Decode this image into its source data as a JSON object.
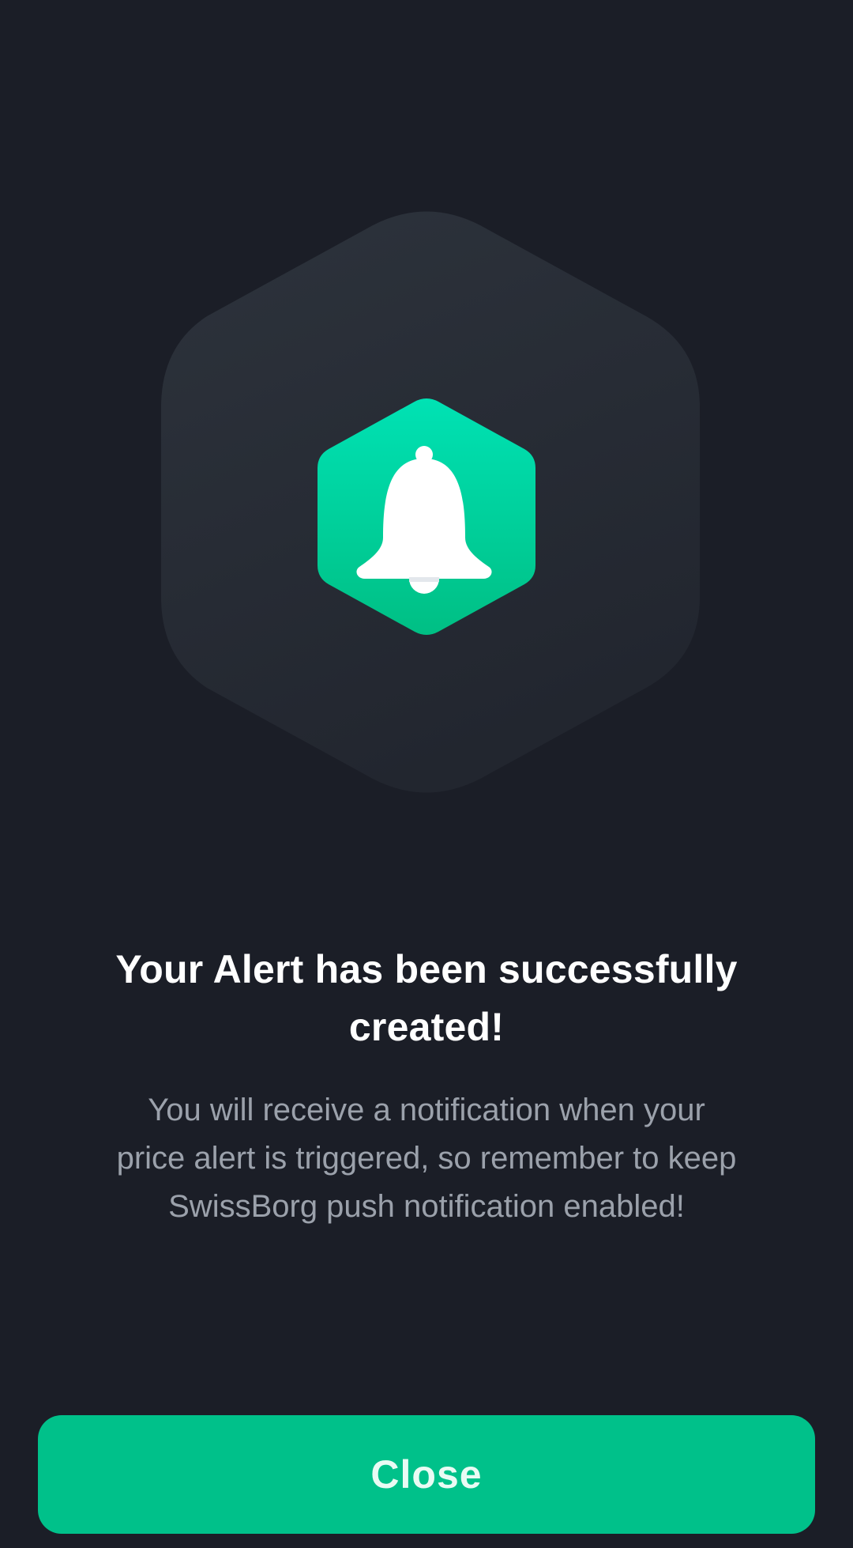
{
  "dialog": {
    "title": "Your Alert has been successfully created!",
    "message": "You will receive a notification when your price alert is triggered, so remember to keep SwissBorg push notification enabled!",
    "close_label": "Close"
  },
  "icon": {
    "name": "bell-icon",
    "accent_color": "#00c18a",
    "background_color": "#1b1e27"
  }
}
